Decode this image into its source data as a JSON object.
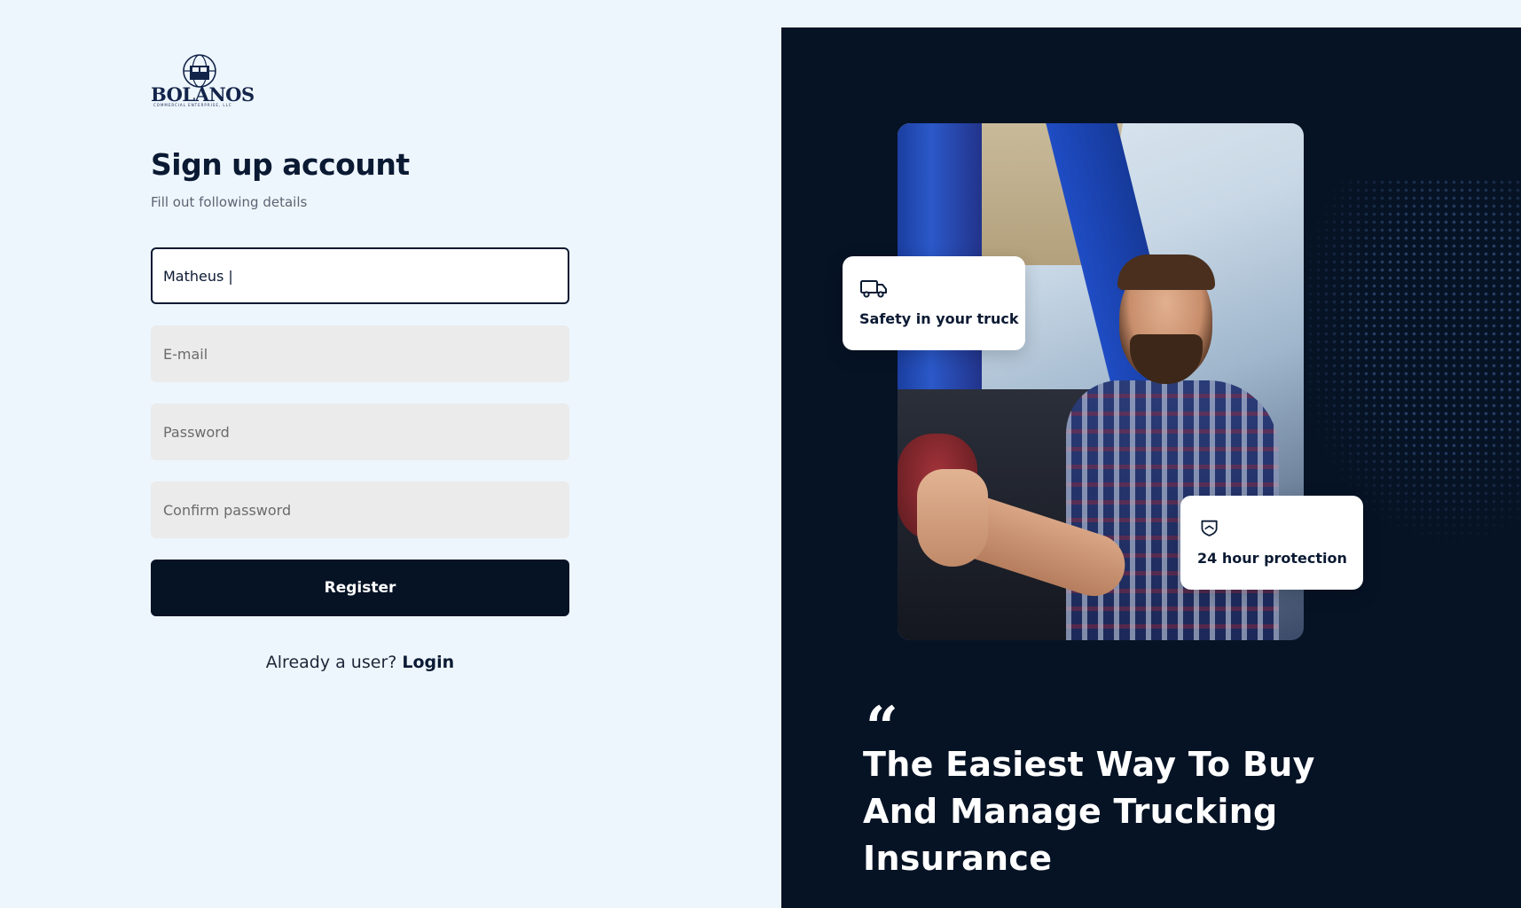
{
  "brand": {
    "name": "BOLANOS",
    "tagline": "COMMERCIAL ENTERPRISE, LLC"
  },
  "form": {
    "title": "Sign up account",
    "subtitle": "Fill out following details",
    "name_value": "Matheus |",
    "email_placeholder": "E-mail",
    "password_placeholder": "Password",
    "confirm_placeholder": "Confirm password",
    "register_label": "Register",
    "login_prompt": "Already a user?",
    "login_link": "Login"
  },
  "hero": {
    "badge_truck": "Safety in your truck",
    "badge_shield": "24 hour protection",
    "quote_mark": "“",
    "headline": "The Easiest Way To Buy And Manage Trucking Insurance"
  },
  "colors": {
    "page_bg": "#eef6fd",
    "panel_bg": "#061325",
    "primary": "#061325",
    "input_bg": "#ebebeb"
  }
}
